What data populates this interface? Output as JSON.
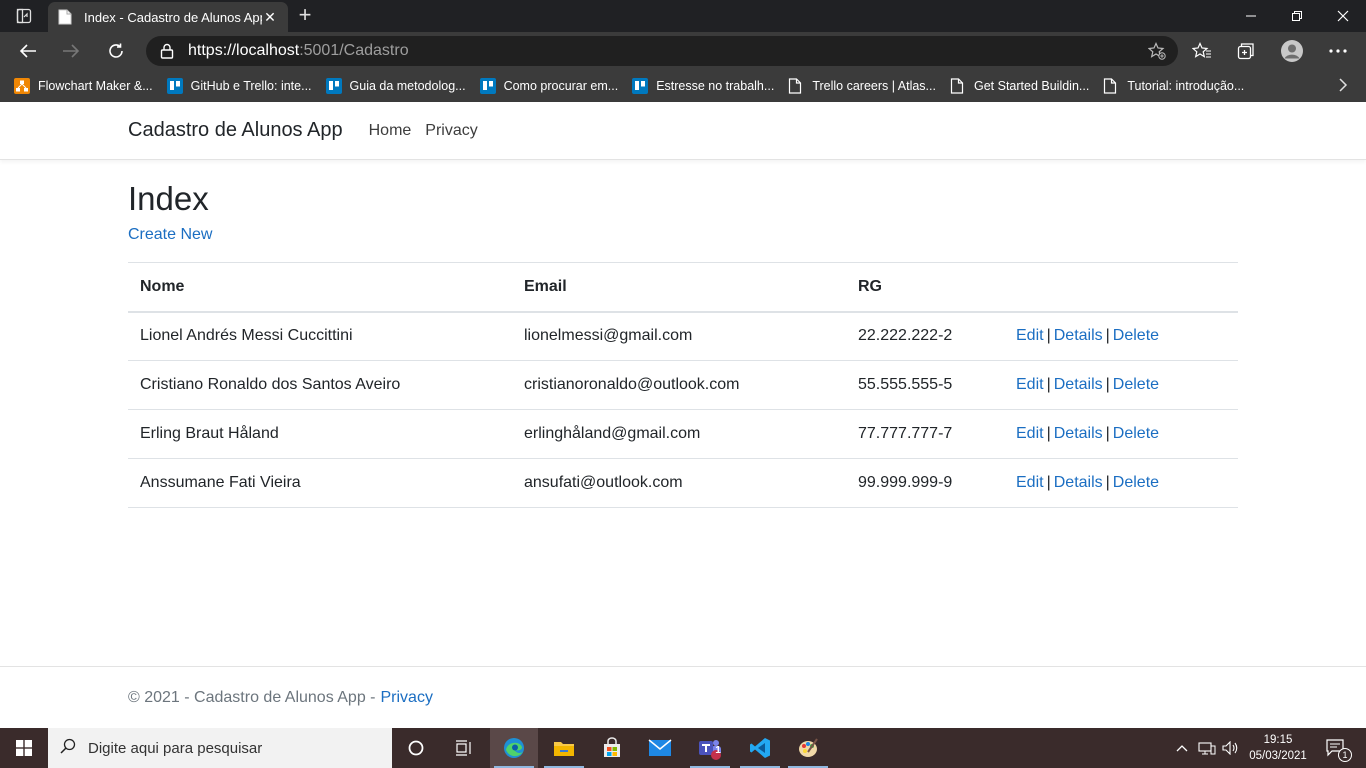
{
  "browser": {
    "tab_title": "Index - Cadastro de Alunos App",
    "url_scheme": "https://",
    "url_host": "localhost",
    "url_rest": ":5001/Cadastro",
    "bookmarks": [
      {
        "label": "Flowchart Maker &...",
        "icon": "drawio-icon",
        "color": "#f08705"
      },
      {
        "label": "GitHub e Trello: inte...",
        "icon": "trello-icon",
        "color": "#0079bf"
      },
      {
        "label": "Guia da metodolog...",
        "icon": "trello-icon",
        "color": "#0079bf"
      },
      {
        "label": "Como procurar em...",
        "icon": "trello-icon",
        "color": "#0079bf"
      },
      {
        "label": "Estresse no trabalh...",
        "icon": "trello-icon",
        "color": "#0079bf"
      },
      {
        "label": "Trello careers | Atlas...",
        "icon": "page-icon",
        "color": "#ffffff"
      },
      {
        "label": "Get Started Buildin...",
        "icon": "page-icon",
        "color": "#ffffff"
      },
      {
        "label": "Tutorial: introdução...",
        "icon": "page-icon",
        "color": "#ffffff"
      }
    ]
  },
  "site": {
    "brand": "Cadastro de Alunos App",
    "nav": {
      "home": "Home",
      "privacy": "Privacy"
    }
  },
  "main": {
    "heading": "Index",
    "create_new": "Create New",
    "columns": {
      "nome": "Nome",
      "email": "Email",
      "rg": "RG"
    },
    "rows": [
      {
        "nome": "Lionel Andrés Messi Cuccittini",
        "email": "lionelmessi@gmail.com",
        "rg": "22.222.222-2"
      },
      {
        "nome": "Cristiano Ronaldo dos Santos Aveiro",
        "email": "cristianoronaldo@outlook.com",
        "rg": "55.555.555-5"
      },
      {
        "nome": "Erling Braut Håland",
        "email": "erlinghåland@gmail.com",
        "rg": "77.777.777-7"
      },
      {
        "nome": "Anssumane Fati Vieira",
        "email": "ansufati@outlook.com",
        "rg": "99.999.999-9"
      }
    ],
    "actions": {
      "edit": "Edit",
      "details": "Details",
      "delete": "Delete",
      "separator": "|"
    }
  },
  "footer": {
    "text": "© 2021 - Cadastro de Alunos App -",
    "privacy": "Privacy"
  },
  "taskbar": {
    "search_placeholder": "Digite aqui para pesquisar",
    "time": "19:15",
    "date": "05/03/2021",
    "teams_badge": "1",
    "notification_count": "1"
  },
  "colors": {
    "link": "#1b6ec2",
    "chrome_dark": "#202124",
    "chrome_mid": "#3b3b3b",
    "taskbar": "#3a2b2b"
  }
}
